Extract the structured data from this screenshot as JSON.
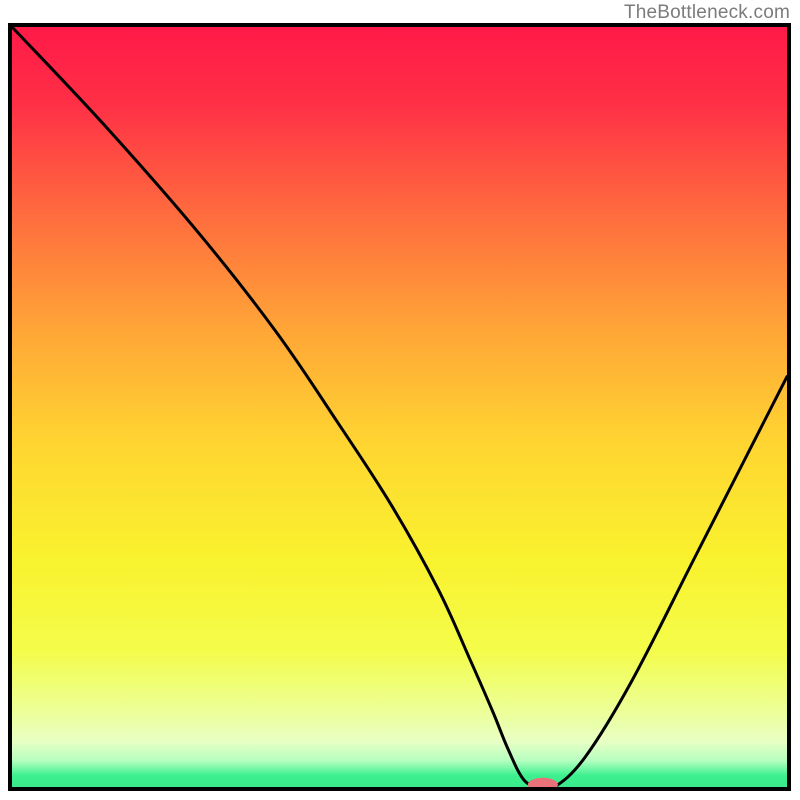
{
  "attribution": "TheBottleneck.com",
  "chart_data": {
    "type": "line",
    "title": "",
    "xlabel": "",
    "ylabel": "",
    "xlim": [
      0,
      100
    ],
    "ylim": [
      0,
      100
    ],
    "gradient_stops": [
      {
        "offset": 0.0,
        "color": "#ff1a48"
      },
      {
        "offset": 0.1,
        "color": "#ff2f46"
      },
      {
        "offset": 0.25,
        "color": "#ff6d3e"
      },
      {
        "offset": 0.4,
        "color": "#ffa637"
      },
      {
        "offset": 0.55,
        "color": "#ffd631"
      },
      {
        "offset": 0.7,
        "color": "#f9f22e"
      },
      {
        "offset": 0.82,
        "color": "#f4fc4a"
      },
      {
        "offset": 0.9,
        "color": "#ecff97"
      },
      {
        "offset": 0.94,
        "color": "#e8ffc4"
      },
      {
        "offset": 0.965,
        "color": "#b6ffc0"
      },
      {
        "offset": 0.985,
        "color": "#3df08f"
      },
      {
        "offset": 1.0,
        "color": "#39e98a"
      }
    ],
    "series": [
      {
        "name": "bottleneck-curve",
        "x": [
          0,
          12,
          24,
          34,
          42,
          49,
          55,
          59,
          62,
          64,
          66,
          68,
          70,
          74,
          80,
          88,
          95,
          100
        ],
        "y": [
          100,
          87,
          73,
          60,
          48,
          37,
          26,
          17,
          10,
          5,
          1,
          0,
          0,
          4,
          14,
          30,
          44,
          54
        ]
      }
    ],
    "marker": {
      "x": 68.5,
      "y": 0.3,
      "color": "#e9717a",
      "rx": 15,
      "ry": 7
    }
  }
}
